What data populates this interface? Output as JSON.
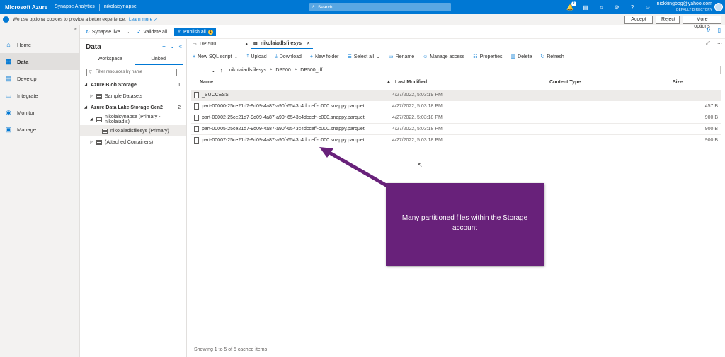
{
  "topbar": {
    "brand": "Microsoft Azure",
    "crumbs": [
      "Synapse Analytics",
      "nikolaisynapse"
    ],
    "search_placeholder": "Search",
    "notification_count": "1",
    "user_email": "nickkingbog@yahoo.com",
    "user_directory": "DEFAULT DIRECTORY"
  },
  "cookie": {
    "message": "We use optional cookies to provide a better experience.",
    "learn_more": "Learn more",
    "accept": "Accept",
    "reject": "Reject",
    "more_options": "More options"
  },
  "leftnav": {
    "items": [
      {
        "label": "Home",
        "icon": "home-icon"
      },
      {
        "label": "Data",
        "icon": "database-icon"
      },
      {
        "label": "Develop",
        "icon": "document-icon"
      },
      {
        "label": "Integrate",
        "icon": "pipeline-icon"
      },
      {
        "label": "Monitor",
        "icon": "gauge-icon"
      },
      {
        "label": "Manage",
        "icon": "toolbox-icon"
      }
    ]
  },
  "toolbar": {
    "workspace": "Synapse live",
    "validate": "Validate all",
    "publish": "Publish all",
    "publish_count": "1"
  },
  "datapanel": {
    "title": "Data",
    "tabs": [
      "Workspace",
      "Linked"
    ],
    "filter_placeholder": "Filter resources by name",
    "tree": [
      {
        "label": "Azure Blob Storage",
        "count": "1"
      },
      {
        "label": "Sample Datasets"
      },
      {
        "label": "Azure Data Lake Storage Gen2",
        "count": "2"
      },
      {
        "label": "nikolaisynapse (Primary - nikolaiadls)"
      },
      {
        "label": "nikolaiadlsfilesys (Primary)"
      },
      {
        "label": "(Attached Containers)"
      }
    ]
  },
  "doctabs": [
    "DP 500",
    "nikolaiadlsfilesys"
  ],
  "commands": [
    "New SQL script",
    "Upload",
    "Download",
    "New folder",
    "Select all",
    "Rename",
    "Manage access",
    "Properties",
    "Delete",
    "Refresh"
  ],
  "path": [
    "nikolaiadlsfilesys",
    "DP500",
    "DP500_df"
  ],
  "grid": {
    "headers": [
      "Name",
      "Last Modified",
      "Content Type",
      "Size"
    ],
    "rows": [
      {
        "name": "_SUCCESS",
        "modified": "4/27/2022, 5:03:19 PM",
        "size": ""
      },
      {
        "name": "part-00000-25ce21d7-9d09-4a87-a90f-6543c4dcceff-c000.snappy.parquet",
        "modified": "4/27/2022, 5:03:18 PM",
        "size": "457 B"
      },
      {
        "name": "part-00002-25ce21d7-9d09-4a87-a90f-6543c4dcceff-c000.snappy.parquet",
        "modified": "4/27/2022, 5:03:18 PM",
        "size": "900 B"
      },
      {
        "name": "part-00005-25ce21d7-9d09-4a87-a90f-6543c4dcceff-c000.snappy.parquet",
        "modified": "4/27/2022, 5:03:18 PM",
        "size": "900 B"
      },
      {
        "name": "part-00007-25ce21d7-9d09-4a87-a90f-6543c4dcceff-c000.snappy.parquet",
        "modified": "4/27/2022, 5:03:18 PM",
        "size": "900 B"
      }
    ],
    "footer": "Showing 1 to 5 of 5 cached items"
  },
  "callout": {
    "text": "Many partitioned files within the Storage account",
    "color": "#68217a"
  },
  "colors": {
    "accent": "#0078d4",
    "publish_badge": "#ffc83d"
  }
}
